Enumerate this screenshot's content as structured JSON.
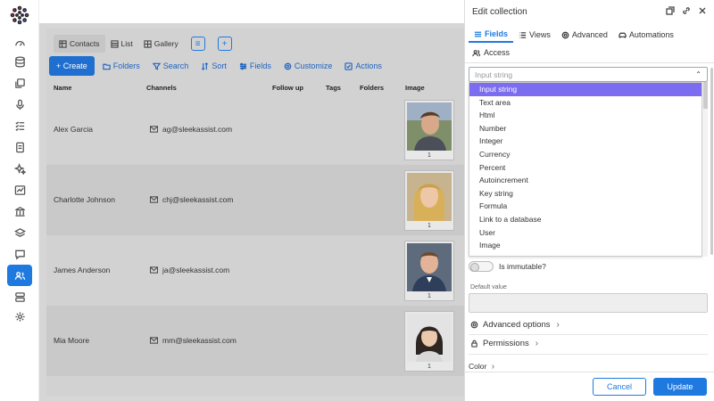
{
  "rail": {
    "icons": [
      "dashboard-icon",
      "database-icon",
      "copy-icon",
      "microphone-icon",
      "checklist-icon",
      "documents-icon",
      "sparkle-icon",
      "chart-icon",
      "bank-icon",
      "layers-icon",
      "chat-icon",
      "contacts-icon",
      "server-icon",
      "settings-icon"
    ],
    "active": "contacts-icon",
    "active_color": "#1f7ae0"
  },
  "views": {
    "tabs": [
      {
        "label": "Contacts",
        "icon": "table-icon",
        "selected": true
      },
      {
        "label": "List",
        "icon": "list-icon",
        "selected": false
      },
      {
        "label": "Gallery",
        "icon": "gallery-icon",
        "selected": false
      }
    ]
  },
  "toolbar": {
    "create": "+ Create",
    "folders": "Folders",
    "search": "Search",
    "sort": "Sort",
    "fields": "Fields",
    "customize": "Customize",
    "actions": "Actions"
  },
  "table": {
    "headers": [
      "Name",
      "Channels",
      "Follow up",
      "Tags",
      "Folders",
      "Image"
    ],
    "rows": [
      {
        "name": "Alex Garcia",
        "email": "ag@sleekassist.com",
        "image_count": "1"
      },
      {
        "name": "Charlotte Johnson",
        "email": "chj@sleekassist.com",
        "image_count": "1"
      },
      {
        "name": "James Anderson",
        "email": "ja@sleekassist.com",
        "image_count": "1"
      },
      {
        "name": "Mia Moore",
        "email": "mm@sleekassist.com",
        "image_count": "1"
      }
    ]
  },
  "panel": {
    "title": "Edit collection",
    "tabs": [
      "Fields",
      "Views",
      "Advanced",
      "Automations"
    ],
    "access": "Access",
    "select_placeholder": "Input string",
    "options": [
      "Input string",
      "Text area",
      "Html",
      "Number",
      "Integer",
      "Currency",
      "Percent",
      "Autoincrement",
      "Key string",
      "Formula",
      "Link to a database",
      "User",
      "Image"
    ],
    "selected_option": "Input string",
    "immutable_label": "Is immutable?",
    "default_value_label": "Default value",
    "advanced_options": "Advanced options",
    "permissions": "Permissions",
    "color": "Color",
    "cancel": "Cancel",
    "update": "Update"
  }
}
